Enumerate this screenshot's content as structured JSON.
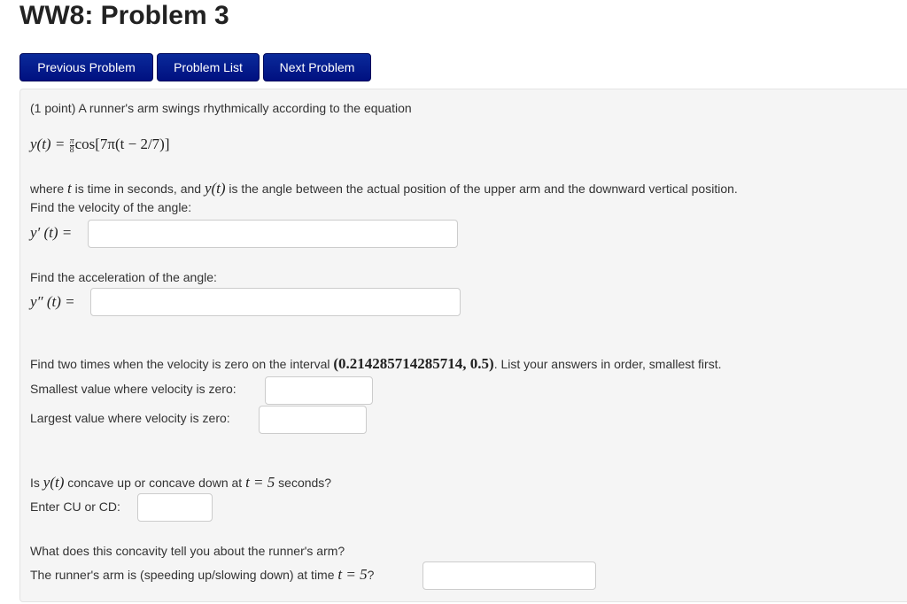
{
  "title": "WW8: Problem 3",
  "nav": {
    "previous": "Previous Problem",
    "list": "Problem List",
    "next": "Next Problem"
  },
  "problem": {
    "intro": "(1 point) A runner's arm swings rhythmically according to the equation",
    "equation": {
      "lhs": "y(t) = ",
      "frac_num": "π",
      "frac_den": "8",
      "rhs": "cos[7π(t − 2/7)]"
    },
    "where": {
      "p1": "where ",
      "t": "t",
      "p2": " is time in seconds, and ",
      "yt": "y(t)",
      "p3": " is the angle between the actual position of the upper arm and the downward vertical position."
    },
    "velocity_prompt": "Find the velocity of the angle:",
    "velocity_label": "y′ (t) =",
    "velocity_value": "",
    "accel_prompt": "Find the acceleration of the angle:",
    "accel_label": "y″ (t) =",
    "accel_value": "",
    "zero_prompt": {
      "p1": "Find two times when the velocity is zero on the interval ",
      "interval": "(0.214285714285714, 0.5)",
      "p2": ". List your answers in order, smallest first."
    },
    "smallest_label": "Smallest value where velocity is zero:",
    "smallest_value": "",
    "largest_label": "Largest value where velocity is zero:",
    "largest_value": "",
    "concave_prompt": {
      "p1": "Is ",
      "yt": "y(t)",
      "p2": " concave up or concave down at ",
      "teq": "t = 5",
      "p3": " seconds?"
    },
    "cucd_label": "Enter CU or CD:",
    "cucd_value": "",
    "arm_prompt": "What does this concavity tell you about the runner's arm?",
    "arm_label": {
      "p1": "The runner's arm is (speeding up/slowing down) at time ",
      "teq": "t = 5",
      "p2": "?"
    },
    "arm_value": ""
  }
}
